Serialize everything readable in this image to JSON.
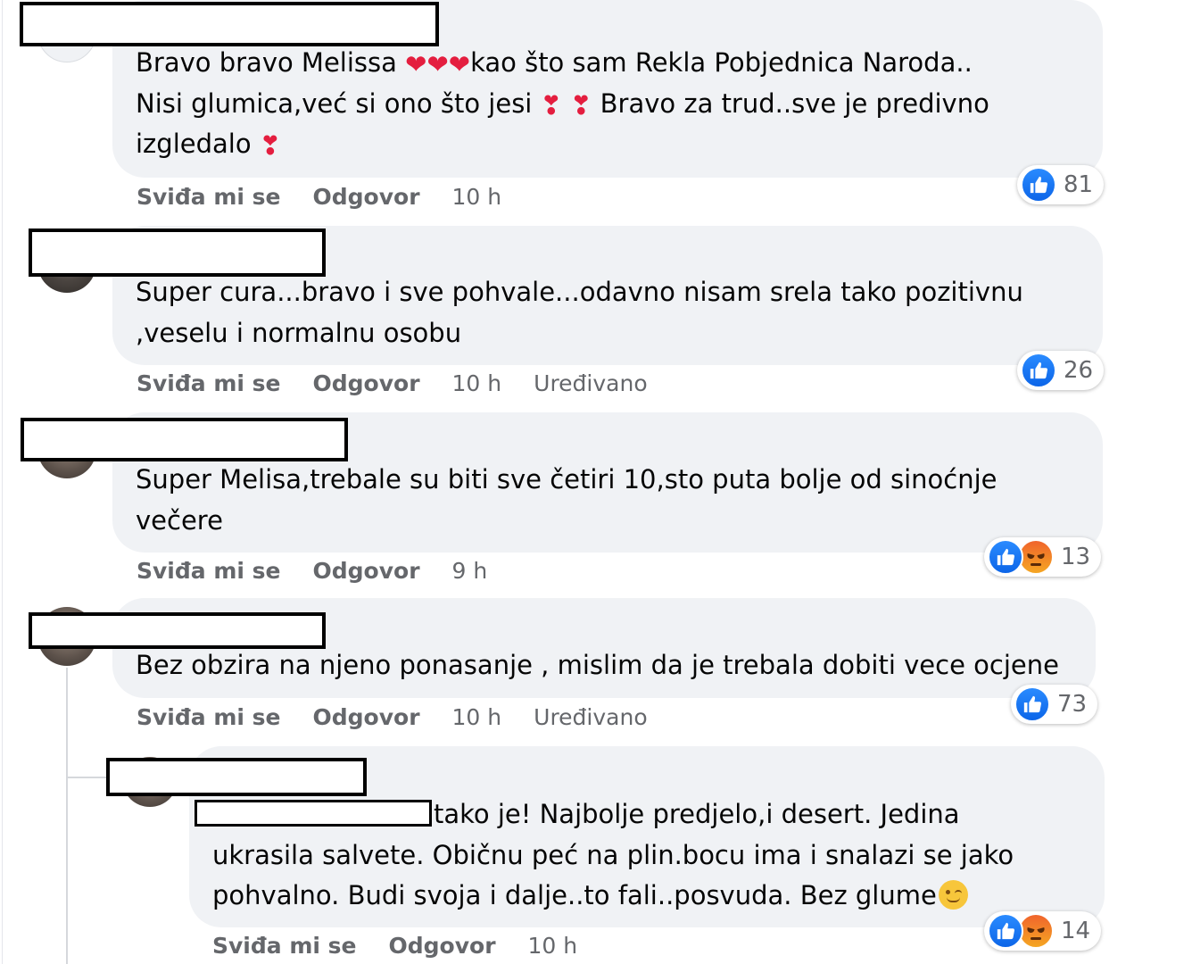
{
  "actions": {
    "like": "Sviđa mi se",
    "reply": "Odgovor",
    "edited": "Uređivano"
  },
  "comments": [
    {
      "text_a": "Bravo bravo Melissa ",
      "text_b": "kao što sam Rekla Pobjednica Naroda..",
      "text_c": "Nisi glumica,već si ono što jesi ",
      "text_d": " Bravo za trud..sve je predivno",
      "text_e": "izgledalo ",
      "emoji_red_heart": "❤",
      "emoji_heart_exclamation": "❣",
      "time": "10 h",
      "reactions": {
        "types": [
          "like"
        ],
        "count": "81"
      }
    },
    {
      "text_a": "Super cura...bravo i sve pohvale...odavno nisam srela tako pozitivnu",
      "text_b": ",veselu i normalnu osobu",
      "time": "10 h",
      "edited": true,
      "reactions": {
        "types": [
          "like"
        ],
        "count": "26"
      }
    },
    {
      "text_a": "Super Melisa,trebale su biti sve četiri 10,sto puta bolje od sinoćnje",
      "text_b": "večere",
      "time": "9 h",
      "reactions": {
        "types": [
          "like",
          "angry"
        ],
        "count": "13"
      }
    },
    {
      "text_a": "Bez obzira na njeno ponasanje , mislim da je trebala dobiti vece ocjene",
      "time": "10 h",
      "edited": true,
      "reactions": {
        "types": [
          "like"
        ],
        "count": "73"
      }
    },
    {
      "text_a": "tako je! Najbolje predjelo,i desert. Jedina",
      "text_b": "ukrasila salvete. Običnu peć na plin.bocu ima i snalazi se jako",
      "text_c": "pohvalno. Budi svoja i dalje..to fali..posvuda. Bez glume",
      "time": "10 h",
      "reactions": {
        "types": [
          "like",
          "angry"
        ],
        "count": "14"
      }
    }
  ],
  "colors": {
    "bubble": "#f0f2f5",
    "like_blue": "#0c65e8",
    "secondary_text": "#65676b",
    "heart_red": "#e41e3f"
  },
  "icons": [
    "like-icon",
    "angry-icon",
    "red-heart-icon",
    "heart-exclamation-icon",
    "winking-face-icon"
  ]
}
